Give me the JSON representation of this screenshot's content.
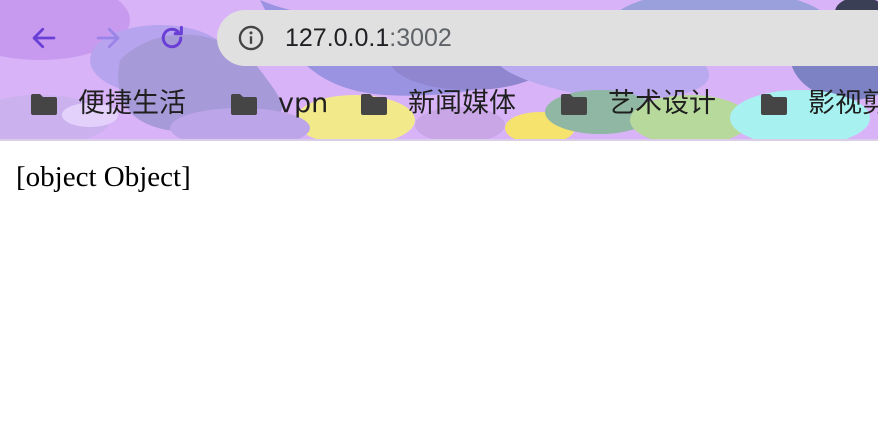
{
  "theme": {
    "accent": "#6a3fd6",
    "accent_disabled": "#9b84e8",
    "omnibox_bg": "#e0e0e0"
  },
  "toolbar": {
    "back_icon": "arrow-left",
    "forward_icon": "arrow-right",
    "reload_icon": "reload"
  },
  "omnibox": {
    "host": "127.0.0.1",
    "port": ":3002",
    "site_info_icon": "info-circle"
  },
  "bookmarks": [
    {
      "label": "便捷生活",
      "icon": "folder"
    },
    {
      "label": "vpn",
      "icon": "folder"
    },
    {
      "label": "新闻媒体",
      "icon": "folder"
    },
    {
      "label": "艺术设计",
      "icon": "folder"
    },
    {
      "label": "影视剪",
      "icon": "folder"
    }
  ],
  "page": {
    "body_text": "[object Object]"
  }
}
